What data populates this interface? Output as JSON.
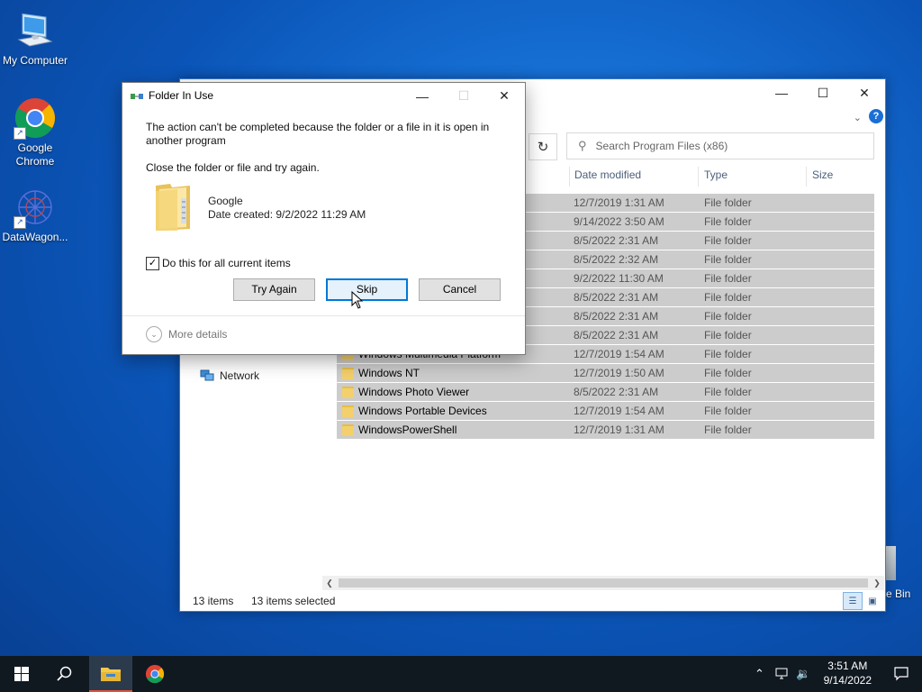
{
  "desktop": {
    "icons": [
      {
        "label": "My Computer"
      },
      {
        "label": "Google Chrome"
      },
      {
        "label": "DataWagon..."
      }
    ],
    "recycle_bin_label": "e Bin"
  },
  "explorer": {
    "search_placeholder": "Search Program Files (x86)",
    "columns": {
      "date": "Date modified",
      "type": "Type",
      "size": "Size"
    },
    "rows": [
      {
        "name": "",
        "date": "12/7/2019 1:31 AM",
        "type": "File folder"
      },
      {
        "name": "",
        "date": "9/14/2022 3:50 AM",
        "type": "File folder"
      },
      {
        "name": "",
        "date": "8/5/2022 2:31 AM",
        "type": "File folder"
      },
      {
        "name": "",
        "date": "8/5/2022 2:32 AM",
        "type": "File folder"
      },
      {
        "name": "",
        "date": "9/2/2022 11:30 AM",
        "type": "File folder"
      },
      {
        "name": "",
        "date": "8/5/2022 2:31 AM",
        "type": "File folder"
      },
      {
        "name": "",
        "date": "8/5/2022 2:31 AM",
        "type": "File folder"
      },
      {
        "name": "",
        "date": "8/5/2022 2:31 AM",
        "type": "File folder"
      },
      {
        "name": "Windows Multimedia Platform",
        "date": "12/7/2019 1:54 AM",
        "type": "File folder"
      },
      {
        "name": "Windows NT",
        "date": "12/7/2019 1:50 AM",
        "type": "File folder"
      },
      {
        "name": "Windows Photo Viewer",
        "date": "8/5/2022 2:31 AM",
        "type": "File folder"
      },
      {
        "name": "Windows Portable Devices",
        "date": "12/7/2019 1:54 AM",
        "type": "File folder"
      },
      {
        "name": "WindowsPowerShell",
        "date": "12/7/2019 1:31 AM",
        "type": "File folder"
      }
    ],
    "nav_network": "Network",
    "status_items": "13 items",
    "status_selected": "13 items selected"
  },
  "dialog": {
    "title": "Folder In Use",
    "message": "The action can't be completed because the folder or a file in it is open in another program",
    "instruction": "Close the folder or file and try again.",
    "item_name": "Google",
    "item_date": "Date created: 9/2/2022 11:29 AM",
    "checkbox_label": "Do this for all current items",
    "checkbox_checked": true,
    "btn_try_again": "Try Again",
    "btn_skip": "Skip",
    "btn_cancel": "Cancel",
    "more_details": "More details"
  },
  "taskbar": {
    "time": "3:51 AM",
    "date": "9/14/2022"
  },
  "colors": {
    "accent": "#0078d7",
    "selection": "#cccccc",
    "taskbar": "#101820"
  }
}
